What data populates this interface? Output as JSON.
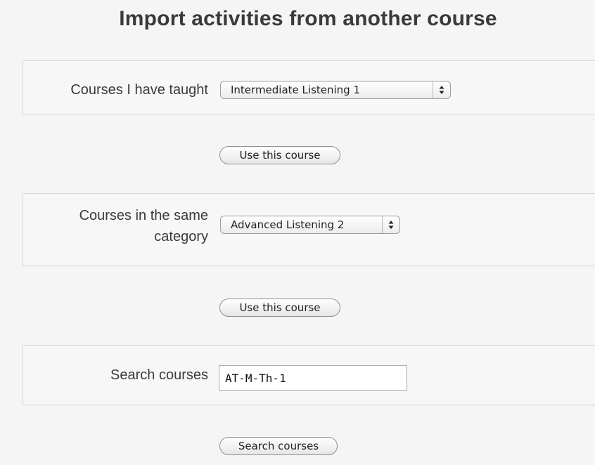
{
  "page": {
    "title": "Import activities from another course"
  },
  "taught": {
    "label": "Courses I have taught",
    "selected": "Intermediate Listening 1",
    "button": "Use this course"
  },
  "same_category": {
    "label": "Courses in the same category",
    "selected": "Advanced Listening 2",
    "button": "Use this course"
  },
  "search": {
    "label": "Search courses",
    "value": "AT-M-Th-1",
    "button": "Search courses"
  },
  "icons": {
    "select_arrows": "up-down-arrows-icon",
    "arrows_glyph": "▴▾"
  }
}
